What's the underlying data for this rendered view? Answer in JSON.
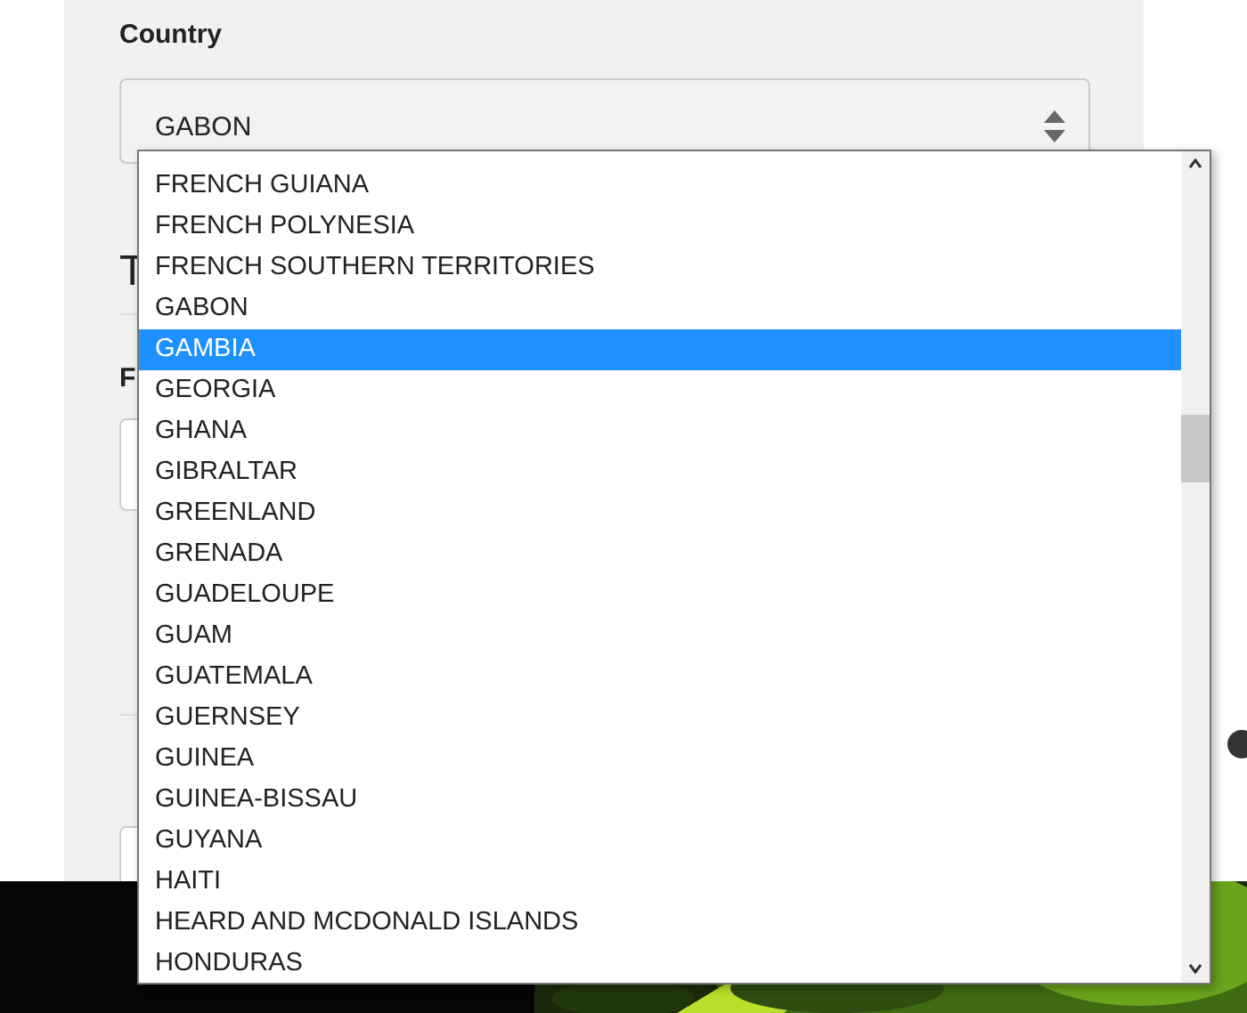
{
  "country_field": {
    "label": "Country",
    "value": "GABON"
  },
  "hidden_headings": [
    {
      "text": "T"
    }
  ],
  "hidden_labels": [
    {
      "text": "F"
    }
  ],
  "dropdown": {
    "options": [
      {
        "label": "FRENCH GUIANA",
        "selected": false
      },
      {
        "label": "FRENCH POLYNESIA",
        "selected": false
      },
      {
        "label": "FRENCH SOUTHERN TERRITORIES",
        "selected": false
      },
      {
        "label": "GABON",
        "selected": false
      },
      {
        "label": "GAMBIA",
        "selected": true
      },
      {
        "label": "GEORGIA",
        "selected": false
      },
      {
        "label": "GHANA",
        "selected": false
      },
      {
        "label": "GIBRALTAR",
        "selected": false
      },
      {
        "label": "GREENLAND",
        "selected": false
      },
      {
        "label": "GRENADA",
        "selected": false
      },
      {
        "label": "GUADELOUPE",
        "selected": false
      },
      {
        "label": "GUAM",
        "selected": false
      },
      {
        "label": "GUATEMALA",
        "selected": false
      },
      {
        "label": "GUERNSEY",
        "selected": false
      },
      {
        "label": "GUINEA",
        "selected": false
      },
      {
        "label": "GUINEA-BISSAU",
        "selected": false
      },
      {
        "label": "GUYANA",
        "selected": false
      },
      {
        "label": "HAITI",
        "selected": false
      },
      {
        "label": "HEARD AND MCDONALD ISLANDS",
        "selected": false
      },
      {
        "label": "HONDURAS",
        "selected": false
      }
    ]
  }
}
